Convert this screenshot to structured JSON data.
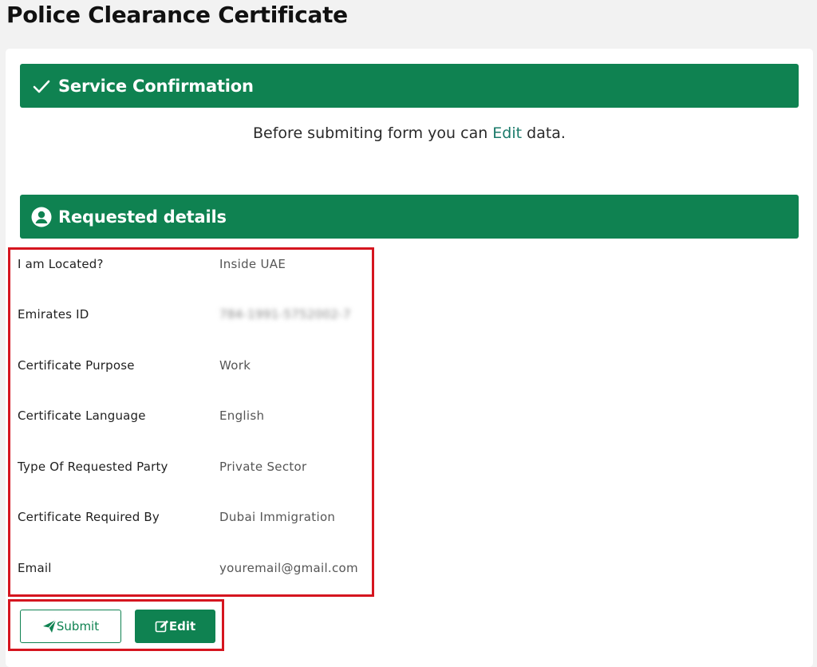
{
  "page": {
    "title": "Police Clearance Certificate"
  },
  "service_confirmation": {
    "title": "Service Confirmation",
    "icon": "check-icon",
    "note_before": "Before submiting form you can ",
    "note_link": "Edit",
    "note_after": " data."
  },
  "requested_details": {
    "title": "Requested details",
    "icon": "user-circle-icon",
    "rows": [
      {
        "label": "I am Located?",
        "value": "Inside UAE"
      },
      {
        "label": "Emirates ID",
        "value": "784-1991-5752002-7"
      },
      {
        "label": "Certificate Purpose",
        "value": "Work"
      },
      {
        "label": "Certificate Language",
        "value": "English"
      },
      {
        "label": "Type Of Requested Party",
        "value": "Private Sector"
      },
      {
        "label": "Certificate Required By",
        "value": "Dubai Immigration"
      },
      {
        "label": "Email",
        "value": "youremail@gmail.com"
      }
    ]
  },
  "actions": {
    "submit_label": "Submit",
    "submit_icon": "paper-plane-icon",
    "edit_label": "Edit",
    "edit_icon": "edit-icon"
  },
  "colors": {
    "brand_green": "#0f8251",
    "highlight_red": "#d5151f",
    "link": "#1a7a6a"
  }
}
